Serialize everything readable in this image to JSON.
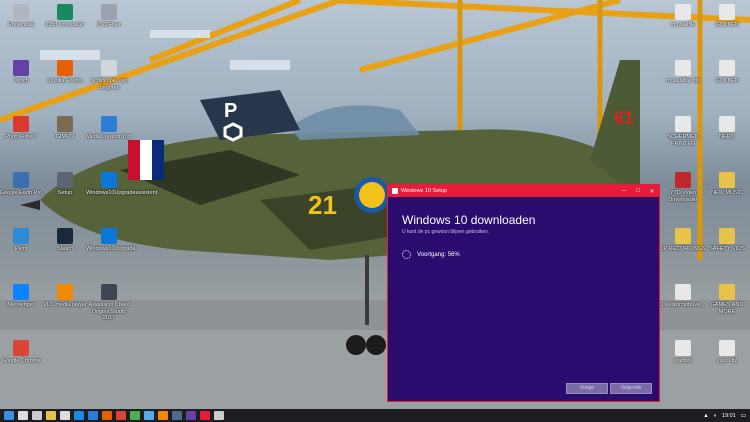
{
  "desktop": {
    "icons_left": [
      {
        "label": "Prullenbak",
        "icon": "recycle-bin-icon",
        "color": "#b0b7c0"
      },
      {
        "label": "IObit Uninstaller",
        "icon": "uninstaller-icon",
        "color": "#178a5f"
      },
      {
        "label": "DVDFlyer",
        "icon": "dvd-icon",
        "color": "#9aa3ad"
      },
      {
        "label": "Twitch",
        "icon": "twitch-icon",
        "color": "#6441a4"
      },
      {
        "label": "Mozilla Firefox",
        "icon": "firefox-icon",
        "color": "#e66000"
      },
      {
        "label": "Schijfkopie van diegoren",
        "icon": "disc-icon",
        "color": "#d0d6dc"
      },
      {
        "label": "PhotoFiltre 7",
        "icon": "photofiltre-icon",
        "color": "#d93a2f"
      },
      {
        "label": "GIMP 2",
        "icon": "gimp-icon",
        "color": "#7b6a55"
      },
      {
        "label": "MediaCreationTool",
        "icon": "media-creation-icon",
        "color": "#2d7dd2"
      },
      {
        "label": "Google Earth Pro",
        "icon": "google-earth-icon",
        "color": "#3a6fb0"
      },
      {
        "label": "Setup",
        "icon": "setup-icon",
        "color": "#5d6570"
      },
      {
        "label": "Windows10Upgradeassistent",
        "icon": "windows-icon",
        "color": "#0b78d7"
      },
      {
        "label": "Paint",
        "icon": "paint-icon",
        "color": "#2f8bd4"
      },
      {
        "label": "Steam",
        "icon": "steam-icon",
        "color": "#1b2838"
      },
      {
        "label": "Windows10Upgrade",
        "icon": "windows-icon",
        "color": "#0b78d7"
      },
      {
        "label": "Messenger",
        "icon": "messenger-icon",
        "color": "#0a84ff"
      },
      {
        "label": "VLC media player",
        "icon": "vlc-icon",
        "color": "#f18a00"
      },
      {
        "label": "Assassins Creed Origins Studio 2017",
        "icon": "game-icon",
        "color": "#3d4552"
      },
      {
        "label": "Google Chrome",
        "icon": "chrome-icon",
        "color": "#db4437"
      }
    ],
    "icons_right": [
      {
        "label": "muvaalfile",
        "icon": "file-icon",
        "color": "#e8e8e8"
      },
      {
        "label": "GOKKEN",
        "icon": "file-icon",
        "color": "#e8e8e8"
      },
      {
        "label": "muvaalfile dfa",
        "icon": "file-icon",
        "color": "#e8e8e8"
      },
      {
        "label": "GOKKEN",
        "icon": "file-icon",
        "color": "#e8e8e8"
      },
      {
        "label": "SCHERMEN PRINTEN",
        "icon": "file-icon",
        "color": "#e8e8e8"
      },
      {
        "label": "NERO",
        "icon": "file-icon",
        "color": "#e8e8e8"
      },
      {
        "label": "YTD Video Downloader",
        "icon": "ytd-icon",
        "color": "#c0272d"
      },
      {
        "label": "NEW MUSIC",
        "icon": "folder-icon",
        "color": "#e8c34a"
      },
      {
        "label": "LP RECORDINGS",
        "icon": "folder-icon",
        "color": "#e8c34a"
      },
      {
        "label": "SAFETY VIDS",
        "icon": "folder-icon",
        "color": "#e8c34a"
      },
      {
        "label": "Overkomstbuve...",
        "icon": "pdf-icon",
        "color": "#e8e8e8"
      },
      {
        "label": "GAMES AND MORE",
        "icon": "folder-icon",
        "color": "#e8c34a"
      },
      {
        "label": "wartbrk",
        "icon": "pdf-icon",
        "color": "#e8e8e8"
      },
      {
        "label": "vuur vitz",
        "icon": "file-icon",
        "color": "#e8e8e8"
      }
    ]
  },
  "jet": {
    "tail_letter": "P",
    "nose_number": "21",
    "tail_number": "61"
  },
  "setup_window": {
    "title": "Windows 10 Setup",
    "heading": "Windows 10 downloaden",
    "subtitle": "U kunt de pc gewoon blijven gebruiken.",
    "progress_label": "Voortgang: 56%",
    "progress_value": 56,
    "back_label": "Vorige",
    "next_label": "Volgende",
    "accent": "#e81b38",
    "background": "#2a0b6e"
  },
  "taskbar": {
    "clock": "19:01",
    "apps": [
      "start-icon",
      "search-icon",
      "task-view-icon",
      "explorer-icon",
      "store-icon",
      "edge-icon",
      "mail-icon",
      "firefox-icon",
      "chrome-icon",
      "media-icon",
      "photos-icon",
      "vlc-icon",
      "steam-icon",
      "twitch-icon",
      "windows-setup-icon",
      "settings-icon"
    ]
  }
}
